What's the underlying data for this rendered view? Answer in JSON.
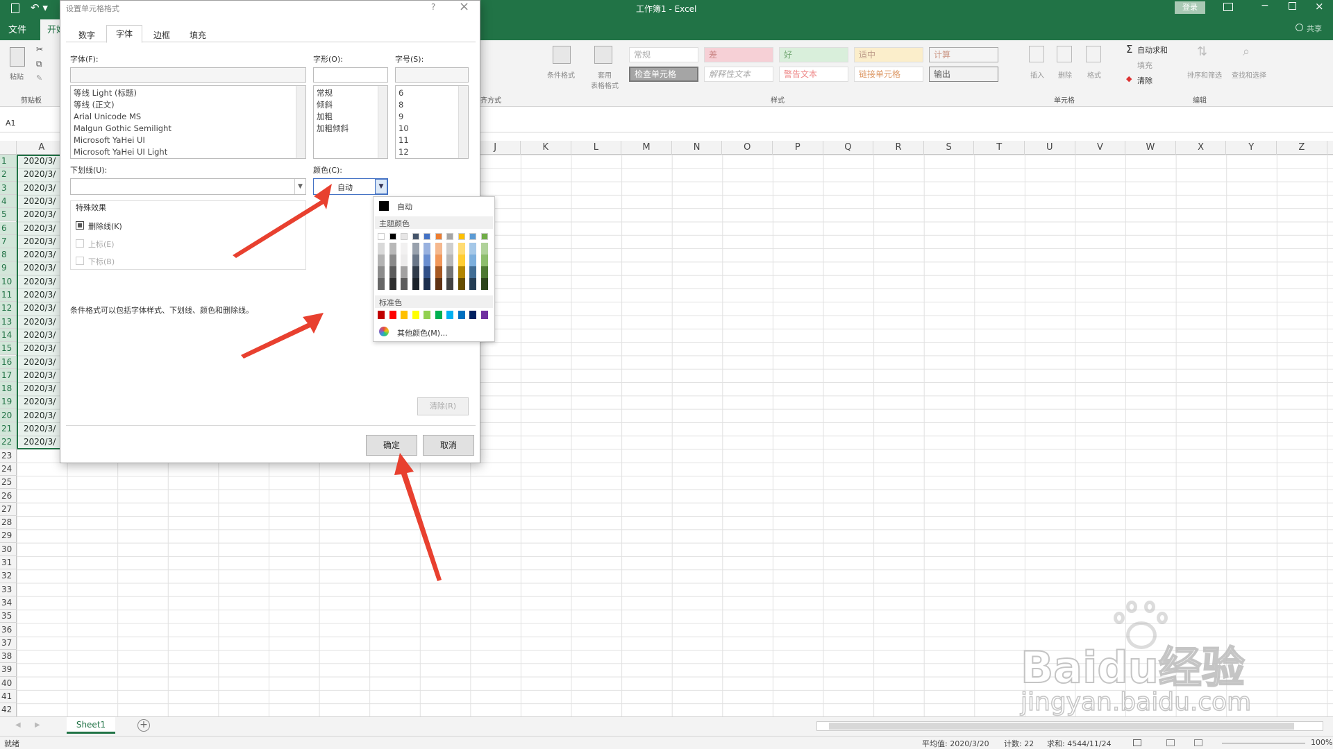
{
  "window": {
    "title": "工作簿1 - Excel",
    "login": "登录",
    "share": "共享"
  },
  "ribbon_tabs": [
    "文件",
    "开始"
  ],
  "ribbon": {
    "clipboard": {
      "paste": "粘贴",
      "cut": "剪切",
      "copy": "复制",
      "format_painter": "格式刷",
      "group": "剪贴板"
    },
    "styles": {
      "conditional_format": "条件格式",
      "table_format": "套用\n表格格式",
      "row1": [
        "常规",
        "差",
        "好",
        "适中",
        "计算"
      ],
      "row2": [
        "检查单元格",
        "解释性文本",
        "警告文本",
        "链接单元格",
        "输出"
      ],
      "group": "样式"
    },
    "cells": {
      "insert": "插入",
      "delete": "删除",
      "format": "格式",
      "group": "单元格"
    },
    "editing": {
      "autosum": "自动求和",
      "fill": "填充",
      "clear": "清除",
      "sort_filter": "排序和筛选",
      "find_select": "查找和选择",
      "group": "编辑"
    },
    "alignment_group": "齐方式"
  },
  "formula_bar": {
    "name_box": "A1"
  },
  "columns": [
    "A",
    "",
    "",
    "",
    "",
    "",
    "",
    "",
    "",
    "J",
    "K",
    "L",
    "M",
    "N",
    "O",
    "P",
    "Q",
    "R",
    "S",
    "T",
    "U",
    "V",
    "W",
    "X",
    "Y",
    "Z"
  ],
  "rows": [
    "1",
    "2",
    "3",
    "4",
    "5",
    "6",
    "7",
    "8",
    "9",
    "10",
    "11",
    "12",
    "13",
    "14",
    "15",
    "16",
    "17",
    "18",
    "19",
    "20",
    "21",
    "22",
    "23",
    "24",
    "25",
    "26",
    "27",
    "28",
    "29",
    "30",
    "31",
    "32",
    "33",
    "34",
    "35",
    "36",
    "37",
    "38",
    "39",
    "40",
    "41",
    "42"
  ],
  "cell_value_prefix": "2020/3/",
  "dialog": {
    "title": "设置单元格格式",
    "help": "?",
    "close": "×",
    "tabs": [
      "数字",
      "字体",
      "边框",
      "填充"
    ],
    "active_tab": "字体",
    "font_label": "字体(F):",
    "font_list": [
      "等线 Light (标题)",
      "等线 (正文)",
      "Arial Unicode MS",
      "Malgun Gothic Semilight",
      "Microsoft YaHei UI",
      "Microsoft YaHei UI Light"
    ],
    "style_label": "字形(O):",
    "style_list": [
      "常规",
      "倾斜",
      "加粗",
      "加粗倾斜"
    ],
    "size_label": "字号(S):",
    "size_list": [
      "6",
      "8",
      "9",
      "10",
      "11",
      "12"
    ],
    "underline_label": "下划线(U):",
    "color_label": "颜色(C):",
    "color_value": "自动",
    "effects_label": "特殊效果",
    "strikethrough": "删除线(K)",
    "superscript": "上标(E)",
    "subscript": "下标(B)",
    "note": "条件格式可以包括字体样式、下划线、颜色和删除线。",
    "clear_btn": "清除(R)",
    "ok": "确定",
    "cancel": "取消"
  },
  "color_popup": {
    "auto": "自动",
    "theme_label": "主题颜色",
    "standard_label": "标准色",
    "more": "其他颜色(M)...",
    "theme_colors": [
      "#ffffff",
      "#000000",
      "#e7e6e6",
      "#44546a",
      "#4472c4",
      "#ed7d31",
      "#a5a5a5",
      "#ffc000",
      "#5b9bd5",
      "#70ad47"
    ],
    "standard_colors": [
      "#c00000",
      "#ff0000",
      "#ffc000",
      "#ffff00",
      "#92d050",
      "#00b050",
      "#00b0f0",
      "#0070c0",
      "#002060",
      "#7030a0"
    ]
  },
  "sheet_tab": "Sheet1",
  "status": {
    "ready": "就绪",
    "avg": "平均值: 2020/3/20",
    "count": "计数: 22",
    "sum": "求和: 4544/11/24",
    "zoom": "100%"
  },
  "watermark": {
    "brand": "Baidu经验",
    "url": "jingyan.baidu.com"
  }
}
